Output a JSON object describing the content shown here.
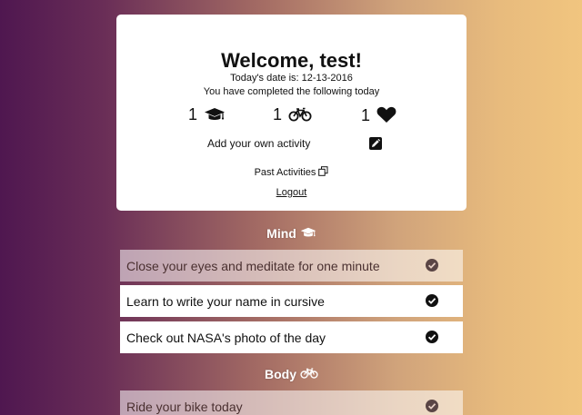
{
  "welcome": {
    "title": "Welcome, test!",
    "date_line": "Today's date is: 12-13-2016",
    "completed_line": "You have completed the following today"
  },
  "counters": [
    {
      "count": "1",
      "icon": "graduation-cap-icon"
    },
    {
      "count": "1",
      "icon": "bicycle-icon"
    },
    {
      "count": "1",
      "icon": "heart-icon"
    }
  ],
  "add_activity": {
    "label": "Add your own activity",
    "icon": "edit-icon"
  },
  "past_activities": {
    "label": "Past Activities",
    "icon": "copy-icon"
  },
  "logout": {
    "label": "Logout"
  },
  "sections": {
    "mind": {
      "title": "Mind",
      "icon": "graduation-cap-icon",
      "activities": [
        {
          "text": "Close your eyes and meditate for one minute",
          "completed": true
        },
        {
          "text": "Learn to write your name in cursive",
          "completed": false
        },
        {
          "text": "Check out NASA's photo of the day",
          "completed": false
        }
      ]
    },
    "body": {
      "title": "Body",
      "icon": "bicycle-icon",
      "activities": [
        {
          "text": "Ride your bike today",
          "completed": true
        }
      ]
    }
  },
  "colors": {
    "gradient_left": "#4f1750",
    "gradient_right": "#f1c57f",
    "card": "#ffffff",
    "text": "#111111"
  }
}
